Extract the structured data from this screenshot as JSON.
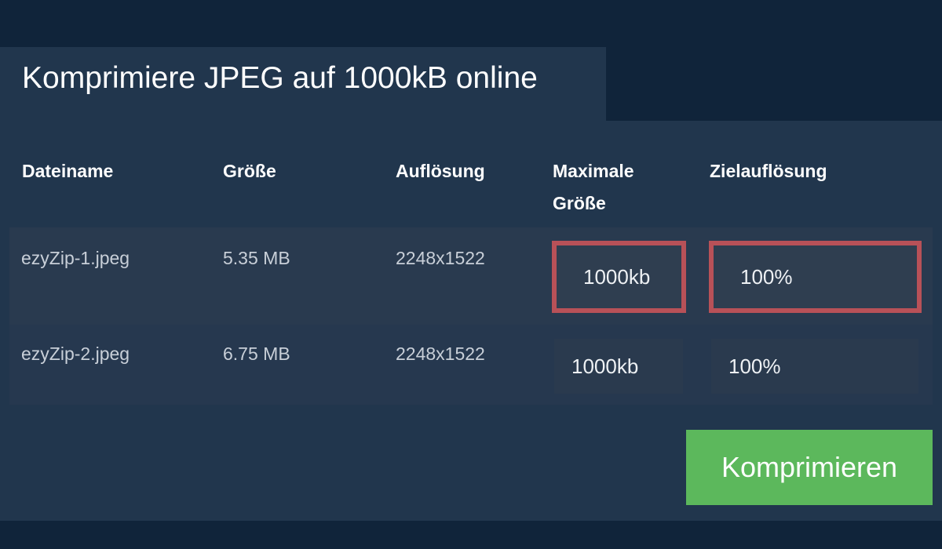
{
  "title": "Komprimiere JPEG auf 1000kB online",
  "table": {
    "headers": {
      "filename": "Dateiname",
      "size": "Größe",
      "resolution": "Auflösung",
      "max_size_line1": "Maximale",
      "max_size_line2": "Größe",
      "target_resolution": "Zielauflösung"
    },
    "rows": [
      {
        "filename": "ezyZip-1.jpeg",
        "size": "5.35 MB",
        "resolution": "2248x1522",
        "max_size": "1000kb",
        "target_resolution": "100%"
      },
      {
        "filename": "ezyZip-2.jpeg",
        "size": "6.75 MB",
        "resolution": "2248x1522",
        "max_size": "1000kb",
        "target_resolution": "100%"
      }
    ]
  },
  "compress_button": "Komprimieren",
  "colors": {
    "background": "#10243a",
    "panel": "#21364d",
    "highlight_border": "#b85158",
    "button": "#5cb85c"
  }
}
